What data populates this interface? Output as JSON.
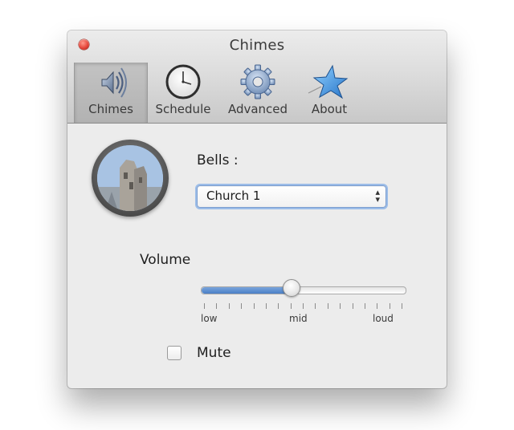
{
  "window": {
    "title": "Chimes"
  },
  "toolbar": {
    "items": [
      {
        "label": "Chimes",
        "icon": "speaker-icon",
        "selected": true
      },
      {
        "label": "Schedule",
        "icon": "clock-icon",
        "selected": false
      },
      {
        "label": "Advanced",
        "icon": "gear-icon",
        "selected": false
      },
      {
        "label": "About",
        "icon": "star-icon",
        "selected": false
      }
    ]
  },
  "chimes": {
    "bells_label": "Bells :",
    "bells_value": "Church 1",
    "volume_label": "Volume",
    "volume_level": 0.44,
    "tick_labels": {
      "low": "low",
      "mid": "mid",
      "loud": "loud"
    },
    "mute_label": "Mute",
    "mute_checked": false
  },
  "colors": {
    "close_button": "#e5463b",
    "slider_fill": "#4a7fc6",
    "select_focus": "#9cbde8"
  }
}
